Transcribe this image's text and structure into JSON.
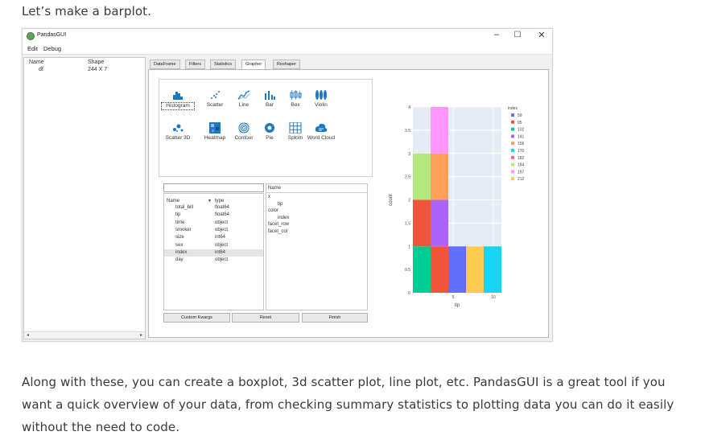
{
  "article": {
    "intro": "Let’s make a barplot.",
    "outro": "Along with these, you can create a boxplot, 3d scatter plot, line plot, etc. PandasGUI is a great tool if you want a quick overview of your data, from checking summary statistics to plotting data you can do it easily without the need to code."
  },
  "window": {
    "title": "PandasGUI",
    "controls": {
      "minimize": "–",
      "maximize": "☐",
      "close": "✕"
    },
    "menu": [
      "Edit",
      "Debug"
    ]
  },
  "dataframes_panel": {
    "headers": [
      "Name",
      "Shape"
    ],
    "rows": [
      {
        "name": "df",
        "shape": "244 X 7"
      }
    ],
    "scroll_left": "◂",
    "scroll_right": "▸"
  },
  "tabs": [
    {
      "label": "DataFrame",
      "active": false
    },
    {
      "label": "Filters",
      "active": false
    },
    {
      "label": "Statistics",
      "active": false
    },
    {
      "label": "Grapher",
      "active": true
    },
    {
      "label": "Reshaper",
      "active": false
    }
  ],
  "plot_types": [
    {
      "label": "Histogram",
      "icon": "histogram-icon",
      "selected": true
    },
    {
      "label": "Scatter",
      "icon": "scatter-icon"
    },
    {
      "label": "Line",
      "icon": "line-icon"
    },
    {
      "label": "Bar",
      "icon": "bar-icon"
    },
    {
      "label": "Box",
      "icon": "box-icon"
    },
    {
      "label": "Violin",
      "icon": "violin-icon"
    },
    {
      "label": "Scatter 3D",
      "icon": "scatter3d-icon"
    },
    {
      "label": "Heatmap",
      "icon": "heatmap-icon"
    },
    {
      "label": "Contour",
      "icon": "contour-icon"
    },
    {
      "label": "Pie",
      "icon": "pie-icon"
    },
    {
      "label": "Splom",
      "icon": "splom-icon"
    },
    {
      "label": "Word Cloud",
      "icon": "wordcloud-icon"
    }
  ],
  "columns": {
    "filter_placeholder": "",
    "headers": {
      "name": "Name",
      "sort": "▼",
      "type": "type"
    },
    "rows": [
      {
        "name": "total_bill",
        "type": "float64"
      },
      {
        "name": "tip",
        "type": "float64"
      },
      {
        "name": "time",
        "type": "object"
      },
      {
        "name": "smoker",
        "type": "object"
      },
      {
        "name": "size",
        "type": "int64"
      },
      {
        "name": "sex",
        "type": "object"
      },
      {
        "name": "index",
        "type": "int64",
        "selected": true
      },
      {
        "name": "day",
        "type": "object"
      }
    ]
  },
  "drop_zones": {
    "header": "Name",
    "items": [
      {
        "label": "x",
        "indent": 0
      },
      {
        "label": "tip",
        "indent": 1
      },
      {
        "label": "color",
        "indent": 0
      },
      {
        "label": "index",
        "indent": 1
      },
      {
        "label": "facet_row",
        "indent": 0
      },
      {
        "label": "facet_col",
        "indent": 0
      }
    ]
  },
  "buttons": {
    "custom_kwargs": "Custom Kwargs",
    "reset": "Reset",
    "finish": "Finish"
  },
  "colors": {
    "plot_bg": "#e5ecf6",
    "series": [
      "#636efa",
      "#ef553b",
      "#00cc96",
      "#ab63fa",
      "#ffa15a",
      "#19d3f3",
      "#ff6692",
      "#b6e880",
      "#ff97ff",
      "#fecb52"
    ]
  },
  "chart_data": {
    "type": "bar",
    "stacked": true,
    "xlabel": "tip",
    "ylabel": "count",
    "x_ticks": [
      5,
      10
    ],
    "y_ticks": [
      0,
      0.5,
      1,
      1.5,
      2,
      2.5,
      3,
      3.5,
      4
    ],
    "ylim": [
      0,
      4
    ],
    "xlim": [
      0,
      11
    ],
    "legend": {
      "title": "index",
      "position": "top-right",
      "entries": [
        "59",
        "95",
        "102",
        "141",
        "156",
        "170",
        "182",
        "184",
        "197",
        "212"
      ]
    },
    "bars": [
      {
        "x": 1,
        "segments": [
          {
            "series": "102",
            "color": "#00cc96",
            "value": 1
          },
          {
            "series": "95",
            "color": "#ef553b",
            "value": 1
          },
          {
            "series": "184",
            "color": "#b6e880",
            "value": 1
          }
        ]
      },
      {
        "x": 2,
        "segments": [
          {
            "series": "95",
            "color": "#ef553b",
            "value": 1
          },
          {
            "series": "141",
            "color": "#ab63fa",
            "value": 1
          },
          {
            "series": "156",
            "color": "#ffa15a",
            "value": 1
          },
          {
            "series": "197",
            "color": "#ff97ff",
            "value": 1
          }
        ]
      },
      {
        "x": 3,
        "segments": [
          {
            "series": "59",
            "color": "#636efa",
            "value": 1
          }
        ]
      },
      {
        "x": 4,
        "segments": [
          {
            "series": "212",
            "color": "#fecb52",
            "value": 1
          }
        ]
      },
      {
        "x": 5,
        "segments": [
          {
            "series": "170",
            "color": "#19d3f3",
            "value": 1
          }
        ]
      }
    ]
  }
}
